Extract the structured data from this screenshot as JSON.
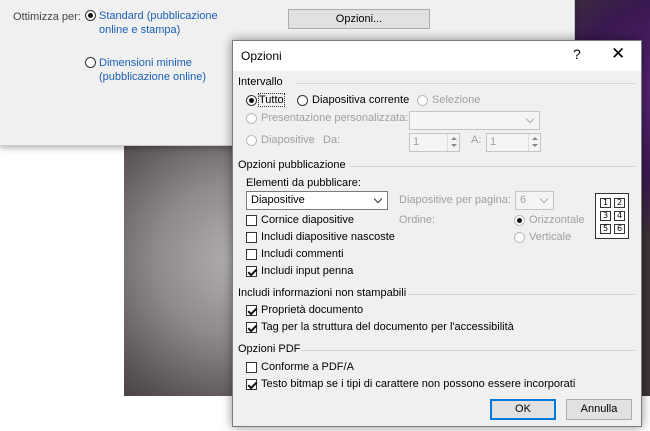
{
  "background_panel": {
    "label": "Ottimizza per:",
    "option_standard": "Standard (pubblicazione online e stampa)",
    "option_minimum": "Dimensioni minime (pubblicazione online)",
    "options_button": "Opzioni..."
  },
  "dialog": {
    "title": "Opzioni",
    "help": "?",
    "close": "✕",
    "range": {
      "heading": "Intervallo",
      "all": "Tutto",
      "current_slide": "Diapositiva corrente",
      "selection": "Selezione",
      "custom_show": "Presentazione personalizzata:",
      "slides": "Diapositive",
      "from_label": "Da:",
      "from_value": "1",
      "to_label": "A:",
      "to_value": "1"
    },
    "publish": {
      "heading": "Opzioni pubblicazione",
      "what_label": "Elementi da pubblicare:",
      "what_value": "Diapositive",
      "per_page_label": "Diapositive per pagina:",
      "per_page_value": "6",
      "order_label": "Ordine:",
      "order_horizontal": "Orizzontale",
      "order_vertical": "Verticale",
      "frame_slides": "Cornice diapositive",
      "include_hidden": "Includi diapositive nascoste",
      "include_comments": "Includi commenti",
      "include_ink": "Includi input penna",
      "order_cells": [
        "1",
        "2",
        "3",
        "4",
        "5",
        "6"
      ]
    },
    "nonprint": {
      "heading": "Includi informazioni non stampabili",
      "doc_properties": "Proprietà documento",
      "struct_tags": "Tag per la struttura del documento per l'accessibilità"
    },
    "pdf": {
      "heading": "Opzioni PDF",
      "pdfa": "Conforme a PDF/A",
      "bitmap_text": "Testo bitmap se i tipi di carattere non possono essere incorporati"
    },
    "ok": "OK",
    "cancel": "Annulla"
  }
}
